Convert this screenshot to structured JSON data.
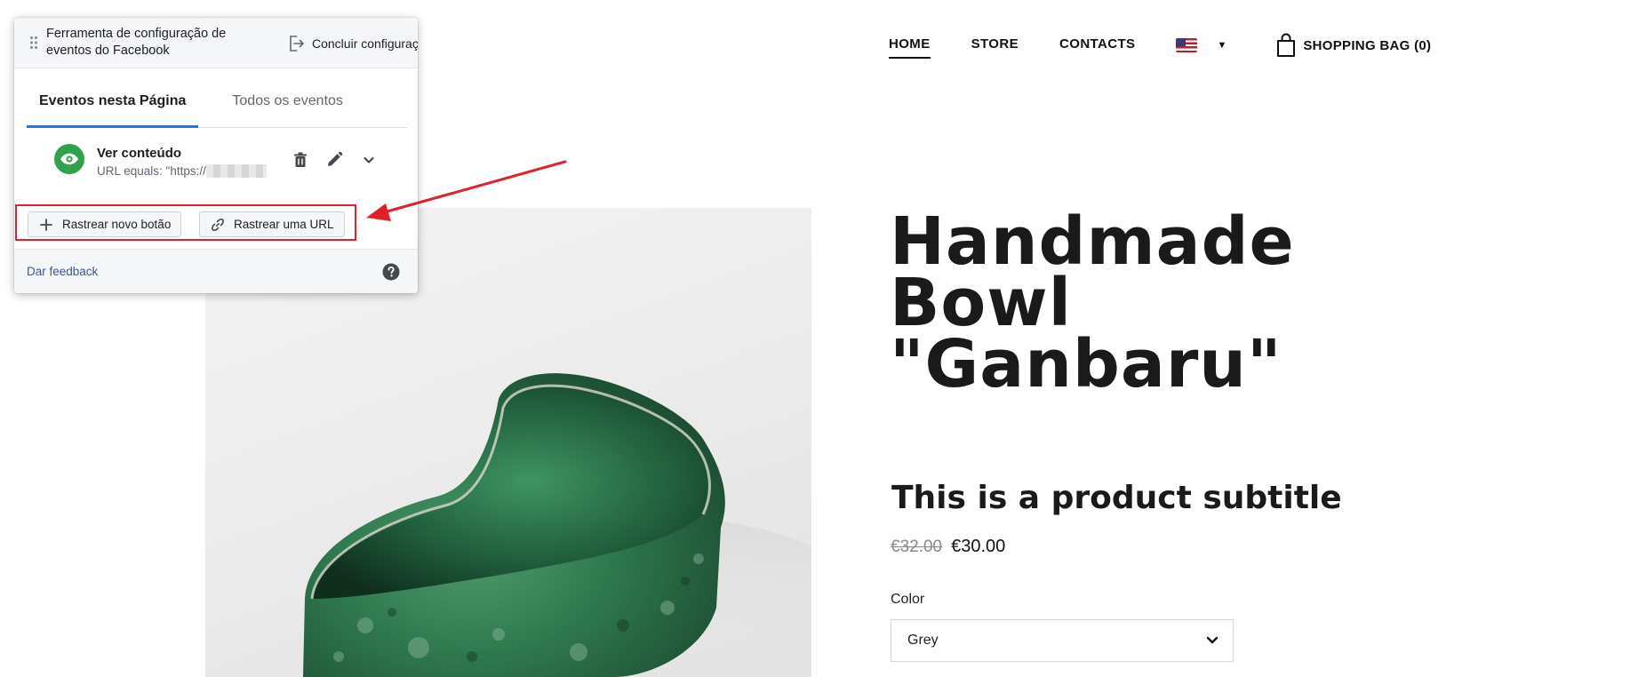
{
  "store": {
    "nav": {
      "home": "HOME",
      "store": "STORE",
      "contacts": "CONTACTS",
      "language_flag": "us-flag-icon",
      "bag_label": "SHOPPING BAG (0)"
    },
    "product": {
      "title_lines": [
        "Handmade",
        "Bowl",
        "\"Ganbaru\""
      ],
      "subtitle": "This is a product subtitle",
      "old_price": "€32.00",
      "price": "€30.00",
      "color_label": "Color",
      "color_value": "Grey"
    }
  },
  "fb_tool": {
    "title": "Ferramenta de configuração de eventos do Facebook",
    "finish_label": "Concluir configuração",
    "tabs": [
      {
        "label": "Eventos nesta Página",
        "active": true
      },
      {
        "label": "Todos os eventos",
        "active": false
      }
    ],
    "event": {
      "name": "Ver conteúdo",
      "rule": "URL equals: \"https://",
      "icon": "eye-icon"
    },
    "buttons": {
      "track_button": "Rastrear novo botão",
      "track_url": "Rastrear uma URL"
    },
    "feedback": "Dar feedback"
  },
  "colors": {
    "fb_blue_tab": "#1877f2",
    "event_green": "#31a24c",
    "highlight_red": "#e0202a",
    "link_blue": "#385898",
    "bowl_green": "#2f7a4f"
  }
}
